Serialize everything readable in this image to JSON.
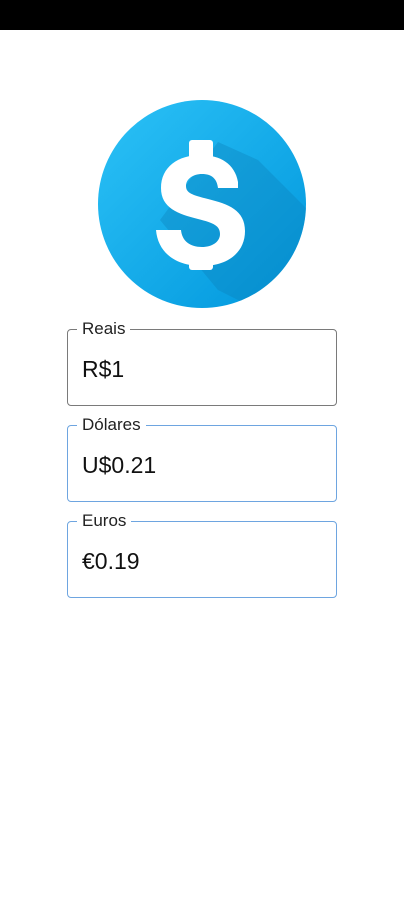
{
  "app": {
    "logo_icon": "dollar-sign-icon",
    "colors": {
      "primary_blue": "#1aaef0",
      "field_border_focus": "#7a7a7a",
      "field_border": "#6ea5e0"
    }
  },
  "fields": {
    "reais": {
      "label": "Reais",
      "value": "R$1"
    },
    "dolares": {
      "label": "Dólares",
      "value": "U$0.21"
    },
    "euros": {
      "label": "Euros",
      "value": "€0.19"
    }
  }
}
